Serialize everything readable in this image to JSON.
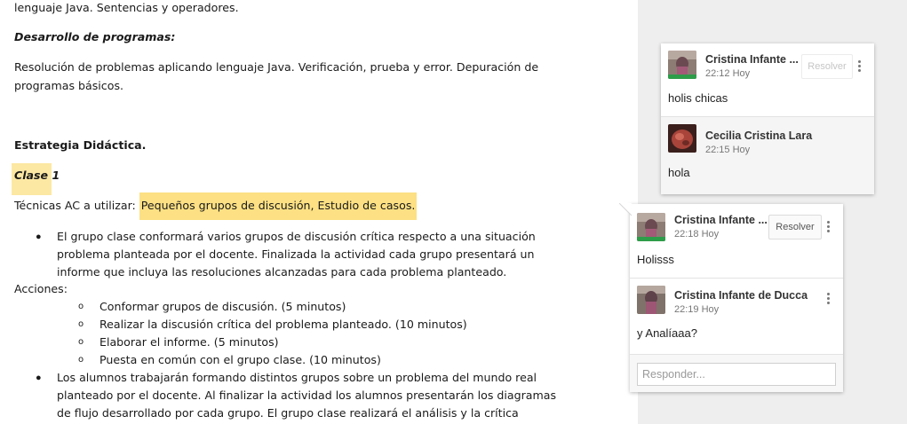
{
  "document": {
    "line_intro": "lenguaje Java. Sentencias y operadores.",
    "heading_desarrollo": "Desarrollo de programas:",
    "desarrollo_line1": "Resolución de problemas aplicando lenguaje Java. Verificación, prueba y error. Depuración de",
    "desarrollo_line2": "programas básicos.",
    "heading_estrategia": "Estrategia Didáctica.",
    "heading_clase": "Clase 1",
    "tecnicas_label": "Técnicas AC a utilizar: ",
    "tecnicas_highlight": "Pequeños grupos de discusión, Estudio de casos.",
    "bullet1_line1": "El grupo clase conformará varios grupos de discusión crítica respecto a una situación",
    "bullet1_line2": "problema planteada por el docente. Finalizada la actividad cada grupo presentará un",
    "bullet1_line3": "informe que incluya las resoluciones alcanzadas para cada problema planteado.",
    "acciones_label": "Acciones:",
    "acciones": [
      "Conformar grupos de discusión. (5 minutos)",
      "Realizar la discusión crítica del problema planteado. (10 minutos)",
      "Elaborar el informe. (5 minutos)",
      "Puesta en común con el grupo clase. (10 minutos)"
    ],
    "bullet2_line1": "Los alumnos trabajarán formando distintos grupos sobre un problema del mundo real",
    "bullet2_line2": "planteado por el docente. Al finalizar la actividad los alumnos presentarán los diagramas",
    "bullet2_line3": "de flujo desarrollado por cada grupo. El grupo clase realizará el análisis y la crítica",
    "bullet_glyph": "●",
    "sub_bullet_glyph": "o"
  },
  "comments": {
    "thread1": {
      "resolve_label": "Resolver",
      "first": {
        "author": "Cristina Infante ...",
        "time": "22:12 Hoy",
        "text": "holis chicas"
      },
      "reply": {
        "author": "Cecilia Cristina Lara",
        "time": "22:15 Hoy",
        "text": "hola"
      }
    },
    "thread2": {
      "resolve_label": "Resolver",
      "first": {
        "author": "Cristina Infante ...",
        "time": "22:18 Hoy",
        "text": "Holisss"
      },
      "reply": {
        "author": "Cristina Infante de Ducca",
        "time": "22:19 Hoy",
        "text": "y Analíaaa?"
      },
      "reply_placeholder": "Responder..."
    }
  },
  "colors": {
    "highlight": "#fce083",
    "sidebar_bg": "#eeeeee",
    "avatar_green": "#2e9d4a"
  }
}
